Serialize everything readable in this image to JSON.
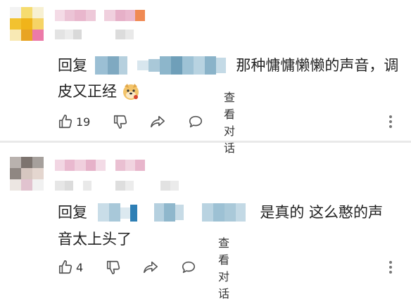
{
  "comments": [
    {
      "reply_prefix": "回复",
      "reply_text_line1": "那种慵慵懒懒的声音，调",
      "reply_text_line2": "皮又正经",
      "emoji": "doge-emoji",
      "likes": "19",
      "view_conversation": "查看对话"
    },
    {
      "reply_prefix": "回复",
      "reply_text_line1": "是真的 这么憨的声",
      "reply_text_line2": "音太上头了",
      "likes": "4",
      "view_conversation": "查看对话"
    }
  ],
  "icons": {
    "like": "thumbs-up-icon",
    "dislike": "thumbs-down-icon",
    "share": "share-icon",
    "reply": "comment-bubble-icon",
    "more": "more-vertical-icon"
  },
  "colors": {
    "text": "#222222",
    "icon": "#555555",
    "divider": "#e9e9e9",
    "mosaic_blue": "#8fb3c8",
    "mosaic_pink": "#e7a9c5"
  }
}
